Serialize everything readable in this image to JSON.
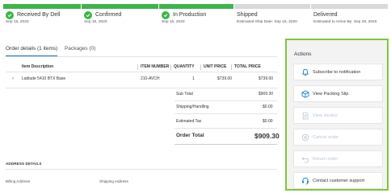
{
  "tracker": {
    "steps": [
      {
        "title": "Received By Dell",
        "date": "Sep 15, 2020",
        "status": "complete"
      },
      {
        "title": "Confirmed",
        "date": "Sep 15, 2020",
        "status": "complete"
      },
      {
        "title": "In Production",
        "date": "Sep 15, 2020",
        "status": "complete"
      },
      {
        "title": "Shipped",
        "date": "Estimated Ship Date: Sep 16, 2020",
        "status": "pending"
      },
      {
        "title": "Delivered",
        "date": "Estimated to Arrive By: Sep 29, 2020",
        "status": "pending"
      }
    ],
    "complete_color": "#3cb44b",
    "pending_color": "#d9d9d9"
  },
  "tabs": [
    {
      "label": "Order details (1 items)",
      "active": true
    },
    {
      "label": "Packages (0)",
      "active": false
    }
  ],
  "table": {
    "headers": [
      "Item Description",
      "ITEM NUMBER",
      "QUANTITY",
      "UNIT PRICE",
      "TOTAL PRICE"
    ],
    "rows": [
      {
        "description": "Latitude 5410 BTX Base",
        "item_number": "210-AVCH",
        "quantity": "1",
        "unit_price": "$739.00",
        "total_price": "$739.00"
      }
    ]
  },
  "summary": {
    "subtotal_label": "Sub Total",
    "subtotal_value": "$909.30",
    "shipping_label": "Shipping/Handling",
    "shipping_value": "$0.00",
    "tax_label": "Estimated Tax",
    "tax_value": "$0.00",
    "total_label": "Order Total",
    "total_value": "$909.30"
  },
  "address": {
    "title": "ADDRESS DETAILS",
    "billing_label": "Billing Address",
    "shipping_label": "Shipping Address"
  },
  "actions": {
    "title": "Actions",
    "border_color": "#7ec63c",
    "items": [
      {
        "label": "Subscribe to notification",
        "icon": "bell-icon",
        "enabled": true
      },
      {
        "label": "View Packing Slip",
        "icon": "box-icon",
        "enabled": true
      },
      {
        "label": "View invoice",
        "icon": "document-icon",
        "enabled": false
      },
      {
        "label": "Cancel order",
        "icon": "cancel-icon",
        "enabled": false
      },
      {
        "label": "Return order",
        "icon": "return-icon",
        "enabled": false
      },
      {
        "label": "Contact customer support",
        "icon": "headset-icon",
        "enabled": true
      }
    ]
  }
}
